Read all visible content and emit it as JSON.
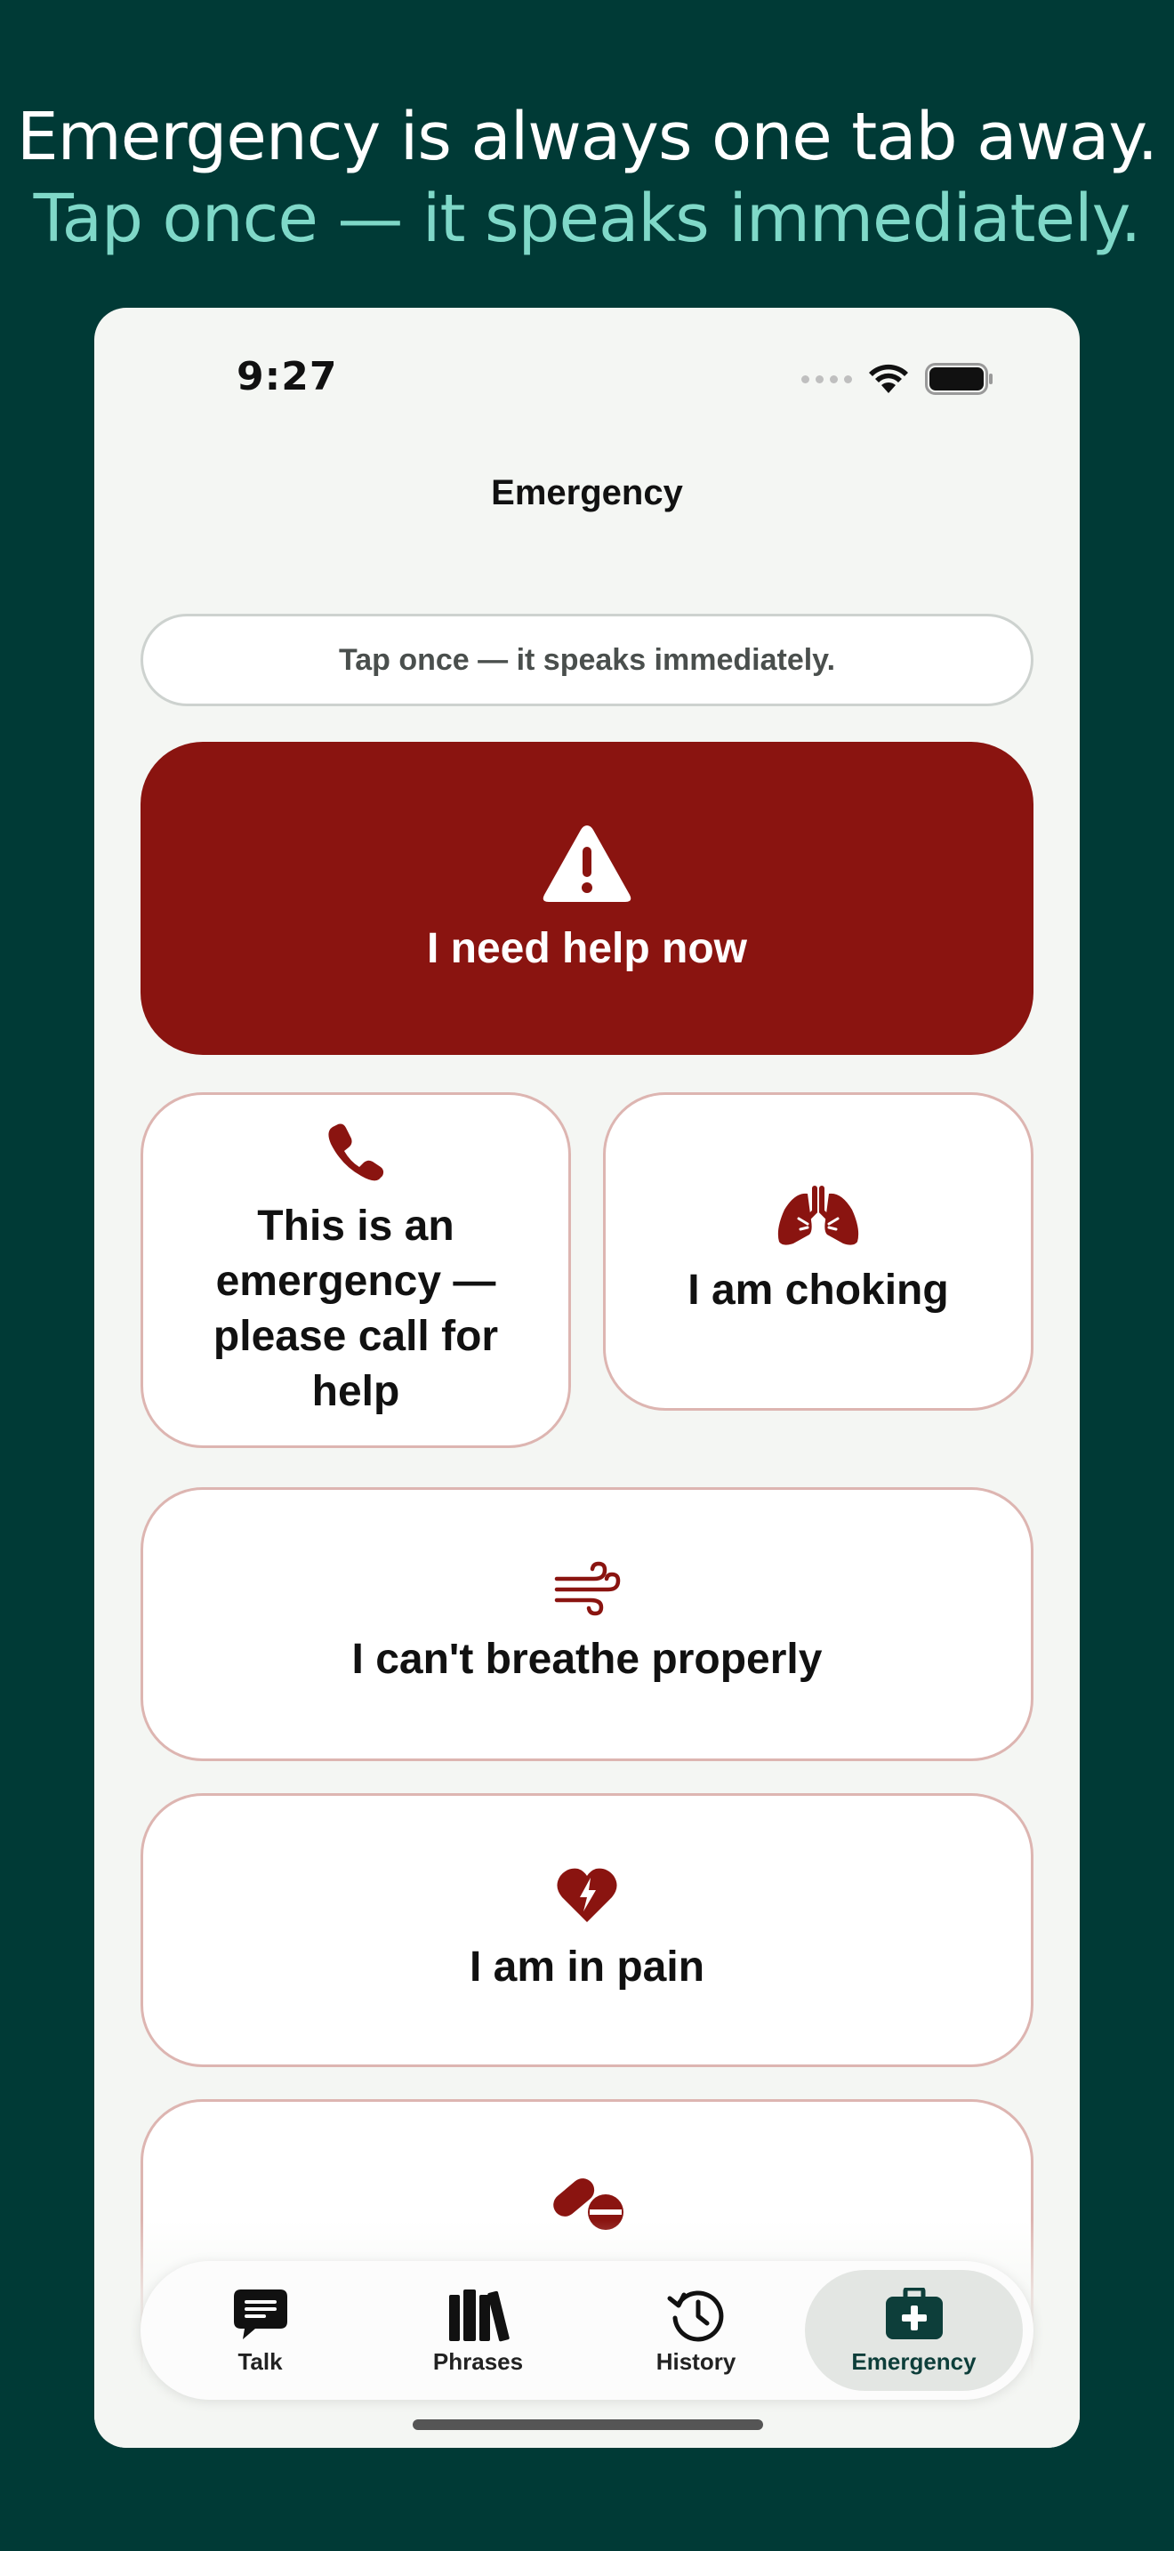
{
  "headline": {
    "line1": "Emergency is always one tab away.",
    "line2": "Tap once — it speaks immediately."
  },
  "status_bar": {
    "time": "9:27"
  },
  "nav": {
    "title": "Emergency"
  },
  "hint": "Tap once — it speaks immediately.",
  "phrases": {
    "help_now": {
      "label": "I need help now",
      "icon": "warning-triangle-icon"
    },
    "call": {
      "label": "This is an emergency — please call for help",
      "icon": "phone-icon"
    },
    "choking": {
      "label": "I am choking",
      "icon": "lungs-icon"
    },
    "breathe": {
      "label": "I can't breathe properly",
      "icon": "wind-icon"
    },
    "pain": {
      "label": "I am in pain",
      "icon": "heart-bolt-icon"
    },
    "meds": {
      "icon": "pills-icon"
    }
  },
  "tabs": [
    {
      "label": "Talk",
      "icon": "speech-bubble-icon"
    },
    {
      "label": "Phrases",
      "icon": "books-icon"
    },
    {
      "label": "History",
      "icon": "clock-history-icon"
    },
    {
      "label": "Emergency",
      "icon": "medical-kit-icon",
      "active": true
    }
  ],
  "colors": {
    "background": "#003a36",
    "accent_text": "#7fd8c8",
    "emergency_red": "#8a1410",
    "card_border": "#ddb5b1",
    "tab_active": "#0d3e3a"
  }
}
